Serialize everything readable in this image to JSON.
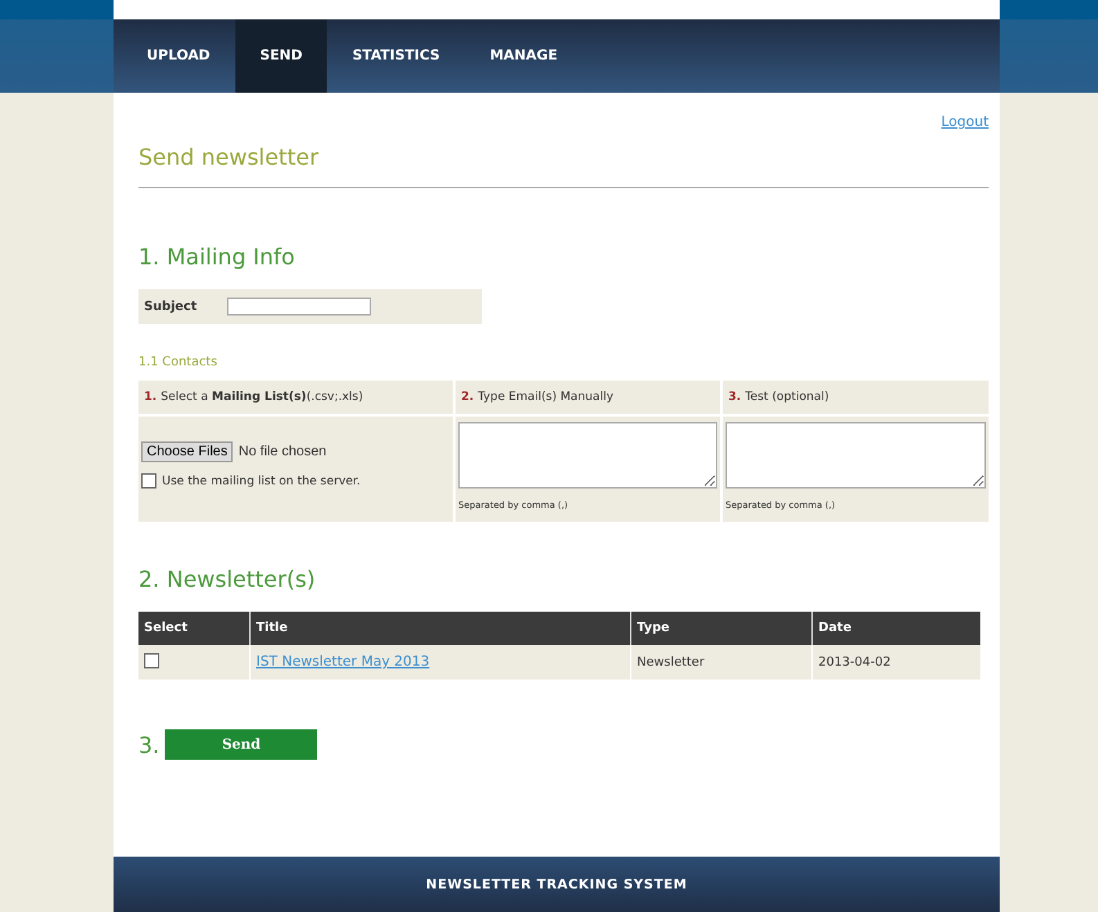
{
  "nav": [
    {
      "label": "UPLOAD",
      "selected": false
    },
    {
      "label": "SEND",
      "selected": true
    },
    {
      "label": "STATISTICS",
      "selected": false
    },
    {
      "label": "MANAGE",
      "selected": false
    }
  ],
  "logout": "Logout",
  "page_title": "Send newsletter",
  "mailing_info": {
    "heading": "1. Mailing Info",
    "subject_label": "Subject",
    "contacts_heading": "1.1 Contacts",
    "columns": [
      {
        "number": "1.",
        "label": "Select a **Mailing List(s)**(.csv;.xls)"
      },
      {
        "number": "2.",
        "label": "Type Email(s) Manually"
      },
      {
        "number": "3.",
        "label": "Test (optional)"
      }
    ],
    "file_button": "Choose Files",
    "file_status": "No file chosen",
    "server_list": {
      "label": "Use the mailing list on the server.",
      "checked": false
    },
    "hints": [
      "Separated by comma (,)",
      "Separated by comma (,)"
    ]
  },
  "newsletters": {
    "heading": "2. Newsletter(s)",
    "columns": [
      "Select",
      "Title",
      "Type",
      "Date"
    ],
    "rows": [
      {
        "selected": false,
        "title": "IST Newsletter May 2013",
        "type": "Newsletter",
        "date": "2013-04-02"
      }
    ]
  },
  "send": {
    "number": "3.",
    "button": "Send"
  },
  "footer": "NEWSLETTER TRACKING SYSTEM"
}
